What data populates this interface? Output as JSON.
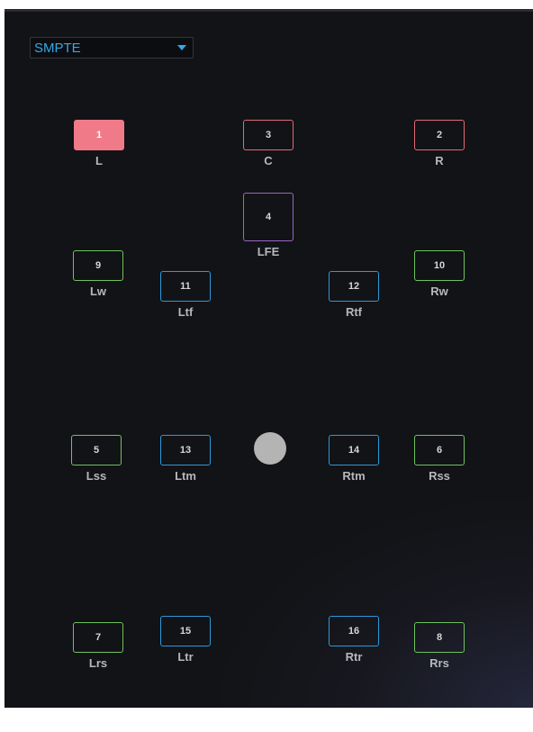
{
  "preset": {
    "selected": "SMPTE"
  },
  "speakers": [
    {
      "id": "1",
      "name": "L",
      "color": "red",
      "active": true
    },
    {
      "id": "3",
      "name": "C",
      "color": "red",
      "active": false
    },
    {
      "id": "2",
      "name": "R",
      "color": "red",
      "active": false
    },
    {
      "id": "4",
      "name": "LFE",
      "color": "purple",
      "active": false
    },
    {
      "id": "9",
      "name": "Lw",
      "color": "green",
      "active": false
    },
    {
      "id": "10",
      "name": "Rw",
      "color": "green",
      "active": false
    },
    {
      "id": "11",
      "name": "Ltf",
      "color": "blue",
      "active": false
    },
    {
      "id": "12",
      "name": "Rtf",
      "color": "blue",
      "active": false
    },
    {
      "id": "5",
      "name": "Lss",
      "color": "green",
      "active": false
    },
    {
      "id": "13",
      "name": "Ltm",
      "color": "blue",
      "active": false
    },
    {
      "id": "14",
      "name": "Rtm",
      "color": "blue",
      "active": false
    },
    {
      "id": "6",
      "name": "Rss",
      "color": "green",
      "active": false
    },
    {
      "id": "7",
      "name": "Lrs",
      "color": "green",
      "active": false
    },
    {
      "id": "15",
      "name": "Ltr",
      "color": "blue",
      "active": false
    },
    {
      "id": "16",
      "name": "Rtr",
      "color": "blue",
      "active": false
    },
    {
      "id": "8",
      "name": "Rrs",
      "color": "green",
      "active": false
    }
  ],
  "colors": {
    "red": "#e06a78",
    "purple": "#9768c2",
    "green": "#6fc25e",
    "blue": "#2c98da",
    "accent": "#35a7e8"
  }
}
